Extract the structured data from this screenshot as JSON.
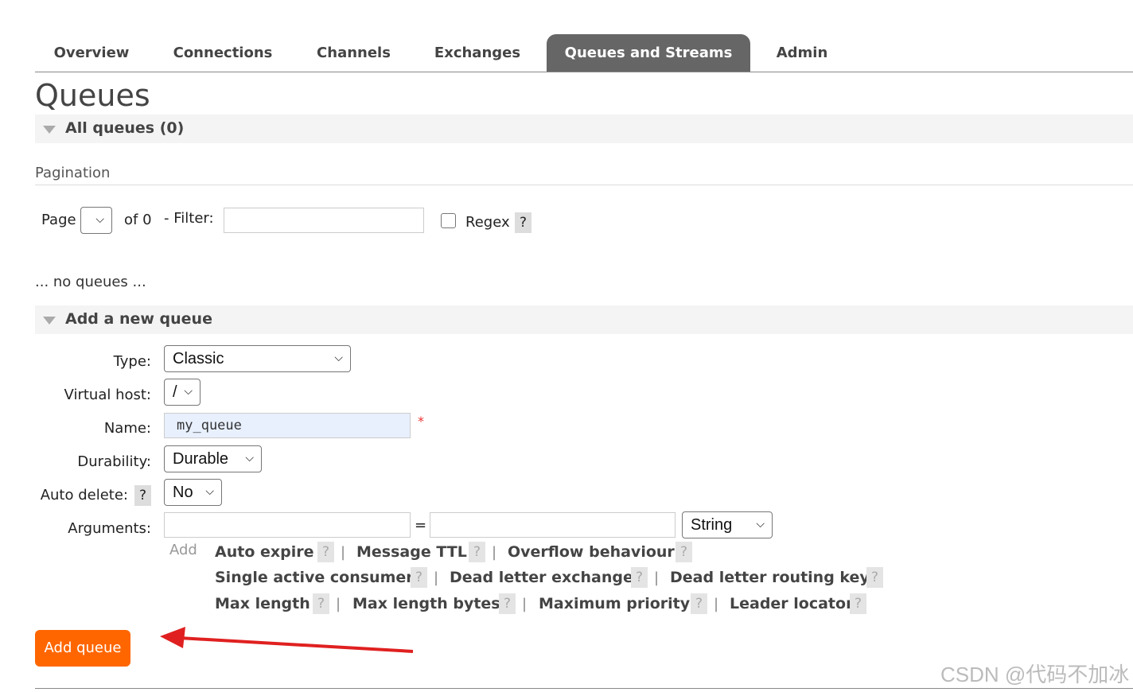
{
  "nav": {
    "tabs": [
      {
        "label": "Overview"
      },
      {
        "label": "Connections"
      },
      {
        "label": "Channels"
      },
      {
        "label": "Exchanges"
      },
      {
        "label": "Queues and Streams",
        "active": true
      },
      {
        "label": "Admin"
      }
    ]
  },
  "page": {
    "title": "Queues",
    "all_queues_label": "All queues (0)",
    "pagination_heading": "Pagination",
    "no_queues_text": "... no queues ..."
  },
  "pagination": {
    "page_label": "Page",
    "of_label": "of 0",
    "filter_label": "- Filter:",
    "filter_value": "",
    "regex_label": "Regex",
    "regex_checked": false,
    "help": "?"
  },
  "add_queue": {
    "section_title": "Add a new queue",
    "type_label": "Type:",
    "type_value": "Classic",
    "vhost_label": "Virtual host:",
    "vhost_value": "/",
    "name_label": "Name:",
    "name_value": "my_queue",
    "required_mark": "*",
    "durability_label": "Durability:",
    "durability_value": "Durable",
    "auto_delete_label": "Auto delete:",
    "auto_delete_value": "No",
    "arguments_label": "Arguments:",
    "arg_key": "",
    "equals": "=",
    "arg_value": "",
    "arg_type": "String",
    "add_label": "Add",
    "help": "?",
    "separator": "|",
    "arg_links": [
      "Auto expire",
      "Message TTL",
      "Overflow behaviour",
      "Single active consumer",
      "Dead letter exchange",
      "Dead letter routing key",
      "Max length",
      "Max length bytes",
      "Maximum priority",
      "Leader locator"
    ],
    "submit_label": "Add queue"
  },
  "annotation": {
    "arrow_color": "#e02020"
  },
  "watermark": "CSDN @代码不加冰",
  "colors": {
    "accent": "#ff6600",
    "active_tab": "#666666",
    "name_field_bg": "#e8f0fe"
  }
}
